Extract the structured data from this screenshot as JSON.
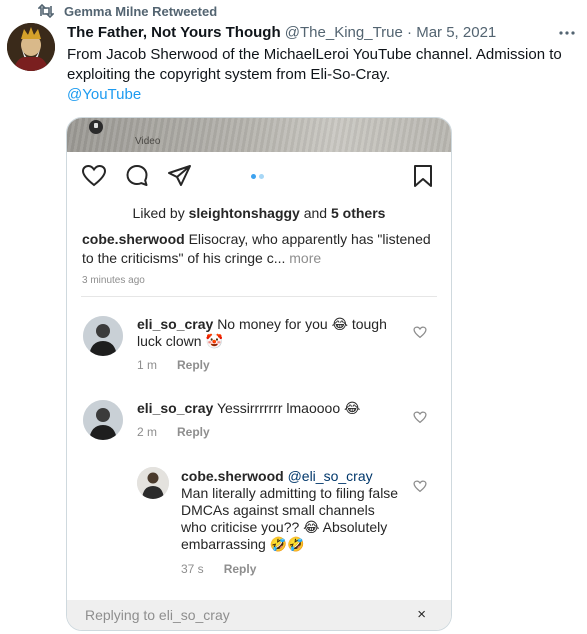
{
  "retweet": {
    "label": "Gemma Milne Retweeted"
  },
  "tweet": {
    "display_name": "The Father, Not Yours Though",
    "handle": "@The_King_True",
    "separator": "·",
    "date": "Mar 5, 2021",
    "text": "From Jacob Sherwood of the MichaelLeroi YouTube channel. Admission to exploiting the copyright system from Eli-So-Cray.",
    "link": "@YouTube"
  },
  "media": {
    "video_label": "Video",
    "liked_prefix": "Liked by",
    "liked_user": "sleightonshaggy",
    "liked_and": "and",
    "liked_others": "5 others",
    "caption_user": "cobe.sherwood",
    "caption_text": "Elisocray, who apparently has \"listened to the criticisms\" of his cringe c...",
    "caption_more": "more",
    "time_ago": "3 minutes ago",
    "comments": [
      {
        "user": "eli_so_cray",
        "text": "No money for you 😂 tough luck clown 🤡",
        "time": "1 m",
        "reply": "Reply"
      },
      {
        "user": "eli_so_cray",
        "text": "Yessirrrrrrr lmaoooo 😂",
        "time": "2 m",
        "reply": "Reply"
      },
      {
        "user": "cobe.sherwood",
        "mention": "@eli_so_cray",
        "text": "Man literally admitting to filing false DMCAs against small channels who criticise you?? 😂 Absolutely embarrassing 🤣🤣",
        "time": "37 s",
        "reply": "Reply"
      }
    ],
    "reply_bar": {
      "text": "Replying to eli_so_cray",
      "close": "×"
    }
  },
  "colors": {
    "link": "#1d9bf0",
    "secondary": "#536471",
    "ig_text": "#262626",
    "ig_muted": "#8e8e8e"
  },
  "icons": [
    "retweet-icon",
    "more-icon",
    "heart-icon",
    "comment-icon",
    "share-icon",
    "bookmark-icon",
    "close-icon"
  ]
}
